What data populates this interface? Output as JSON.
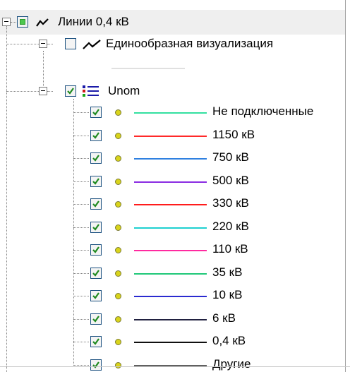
{
  "root": {
    "label": "Линии 0,4 кВ"
  },
  "uniform": {
    "label": "Единообразная визуализация"
  },
  "unom": {
    "label": "Unom"
  },
  "items": [
    {
      "label": "Не подключенные",
      "color": "#33e0a0"
    },
    {
      "label": "1150 кВ",
      "color": "#ff2a2a"
    },
    {
      "label": "750 кВ",
      "color": "#2f80e0"
    },
    {
      "label": "500 кВ",
      "color": "#8a2be2"
    },
    {
      "label": "330 кВ",
      "color": "#ff1c1c"
    },
    {
      "label": "220 кВ",
      "color": "#20d0d0"
    },
    {
      "label": "110 кВ",
      "color": "#ff2aa0"
    },
    {
      "label": "35 кВ",
      "color": "#20c878"
    },
    {
      "label": "10 кВ",
      "color": "#2a2ad0"
    },
    {
      "label": "6 кВ",
      "color": "#202040"
    },
    {
      "label": "0,4 кВ",
      "color": "#101010"
    },
    {
      "label": "Другие",
      "color": "#606060"
    }
  ]
}
